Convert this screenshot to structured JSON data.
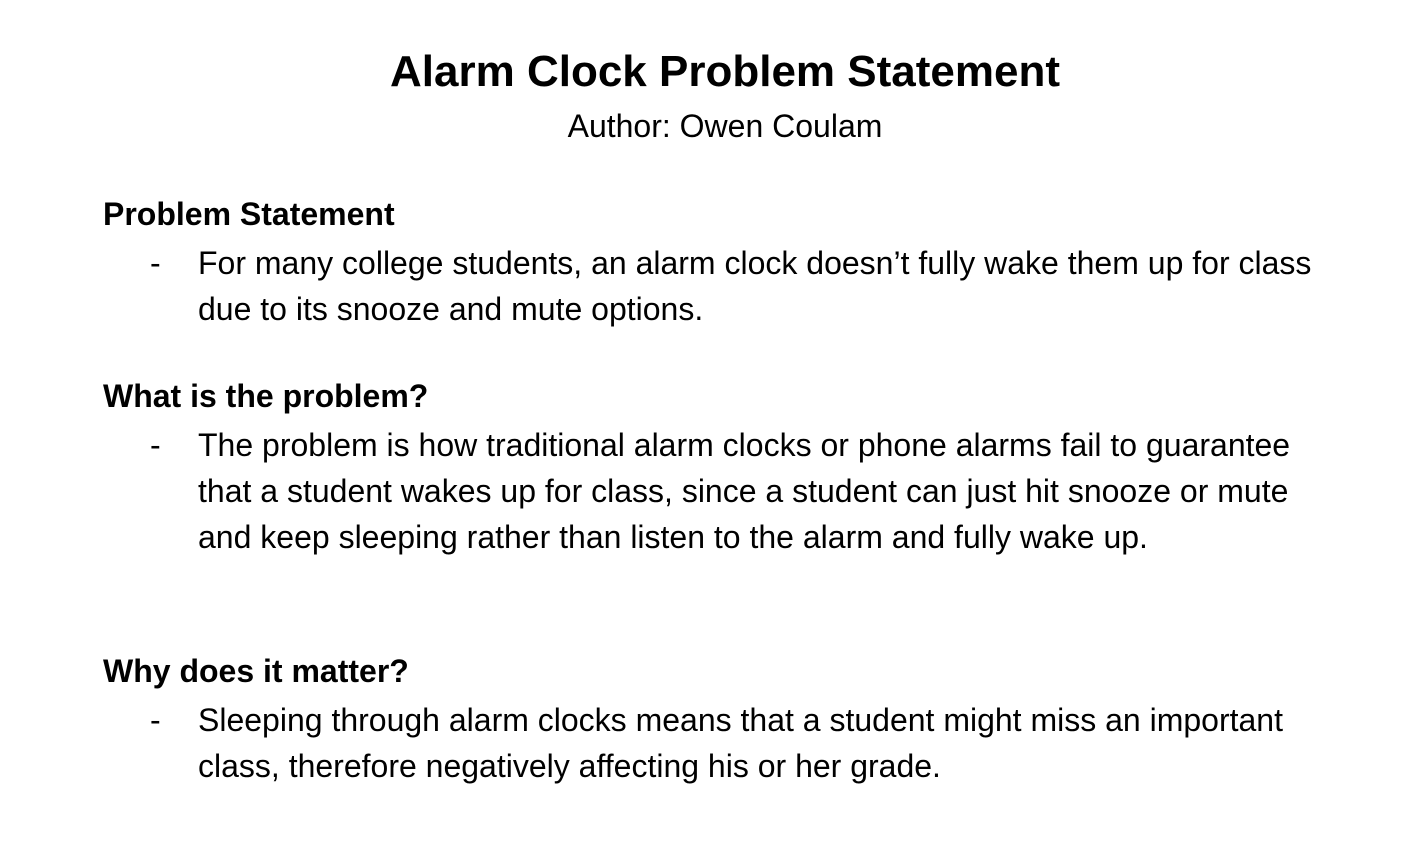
{
  "document": {
    "title": "Alarm Clock Problem Statement",
    "author": "Author: Owen Coulam",
    "sections": [
      {
        "heading": "Problem Statement",
        "bullet_marker": "-",
        "bullet": "For many college students, an alarm clock doesn’t fully wake them up for class due to its snooze and mute options."
      },
      {
        "heading": "What is the problem?",
        "bullet_marker": "-",
        "bullet": "The problem is how traditional alarm clocks or phone alarms fail to guarantee that a student wakes up for class, since a student can just hit snooze or mute and keep sleeping rather than listen to the alarm and fully wake up."
      },
      {
        "heading": "Why does it matter?",
        "bullet_marker": "-",
        "bullet": "Sleeping through alarm clocks means that a student might miss an important class, therefore negatively affecting his or her grade."
      }
    ]
  }
}
